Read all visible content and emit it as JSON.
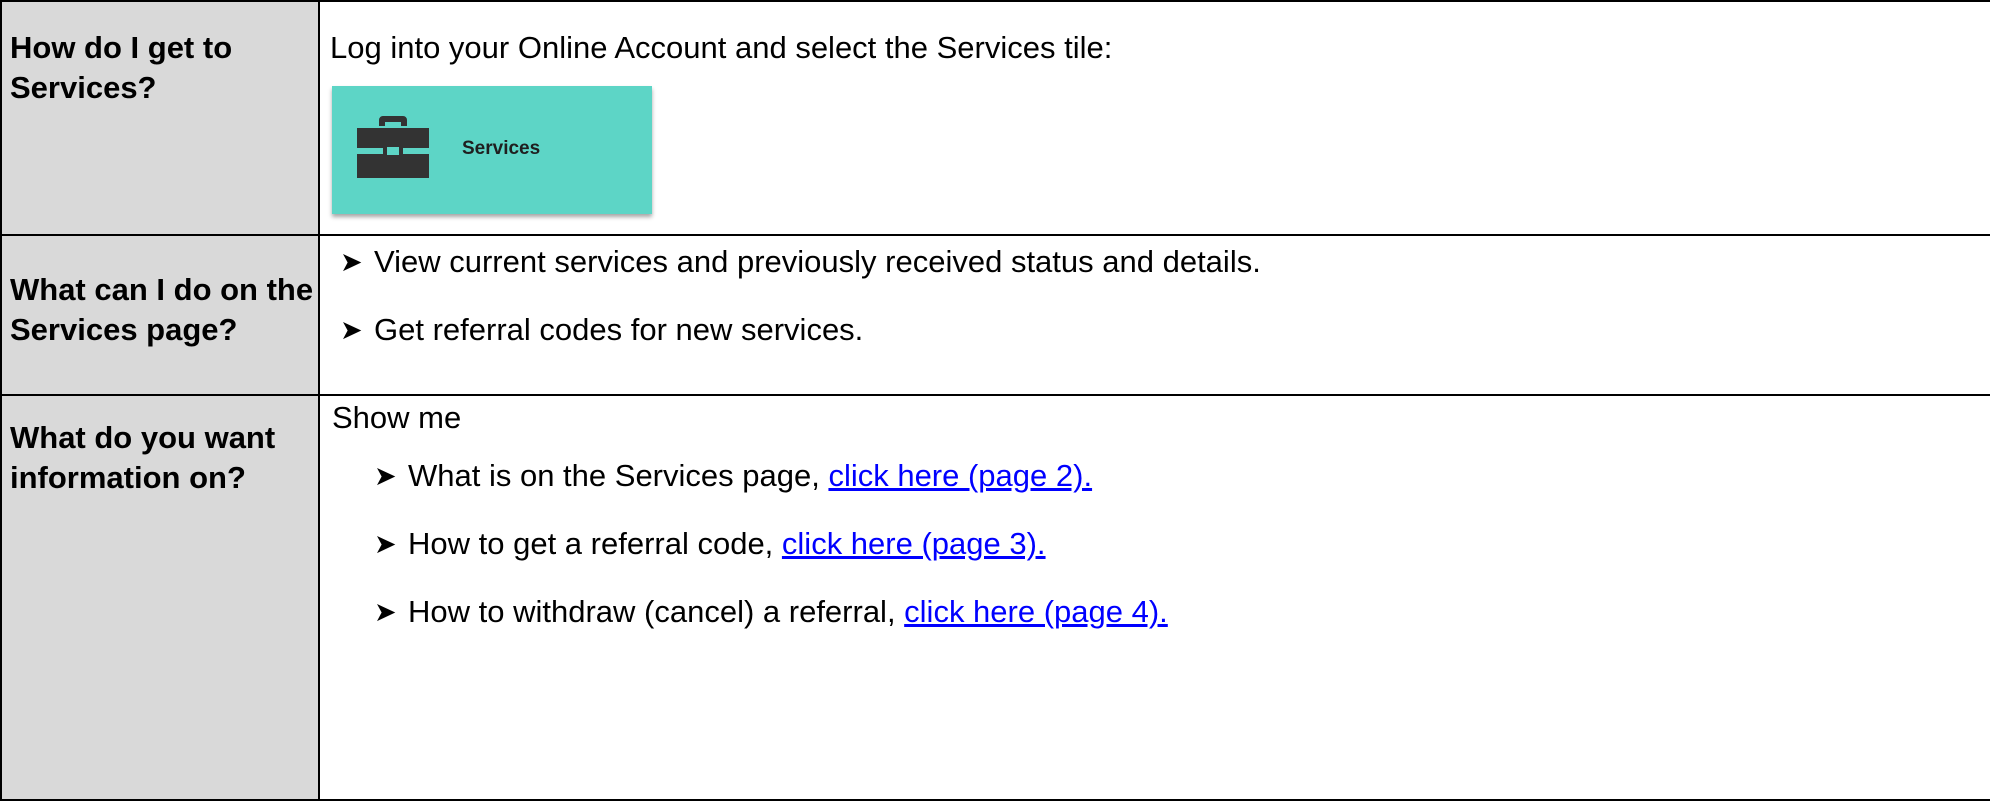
{
  "rows": [
    {
      "question": "How do I get to Services?",
      "answer_intro": "Log into your Online Account and select the Services tile:",
      "tile": {
        "label": "Services",
        "icon": "briefcase-icon",
        "background": "#5dd5c6"
      }
    },
    {
      "question": "What can I do on the Services page?",
      "items": [
        "View current services and previously received status and details.",
        "Get referral codes for new services."
      ]
    },
    {
      "question": "What do you want information on?",
      "intro": "Show me",
      "items": [
        {
          "text": "What is on the Services page, ",
          "link": "click here (page 2)."
        },
        {
          "text": "How to get a referral code, ",
          "link": "click here (page 3)."
        },
        {
          "text": "How to withdraw (cancel) a referral, ",
          "link": "click here (page 4)."
        }
      ]
    }
  ],
  "colors": {
    "question_bg": "#d9d9d9",
    "link": "#0000ff",
    "border": "#000000"
  }
}
